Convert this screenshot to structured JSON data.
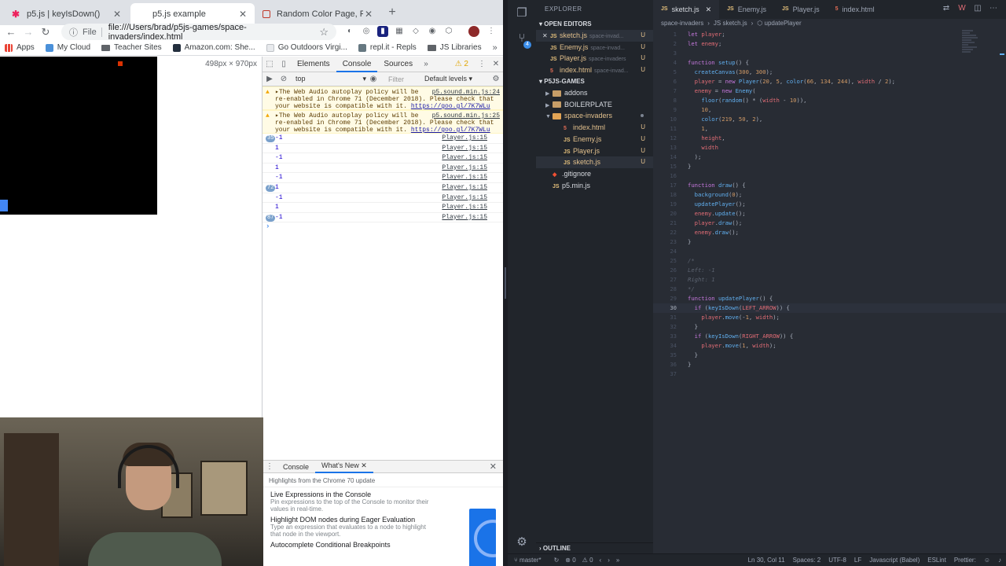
{
  "chrome": {
    "tabs": [
      {
        "title": "p5.js | keyIsDown()",
        "icon": "p5-asterisk-icon",
        "active": false
      },
      {
        "title": "p5.js example",
        "icon": "blank-page-icon",
        "active": true
      },
      {
        "title": "Random Color Page, RGB = db",
        "icon": "page-icon",
        "active": false
      }
    ],
    "new_tab": "+",
    "url_protocol": "File",
    "url": "file:///Users/brad/p5js-games/space-invaders/index.html",
    "bookmarks": [
      {
        "label": "Apps",
        "type": "apps"
      },
      {
        "label": "My Cloud",
        "type": "site"
      },
      {
        "label": "Teacher Sites",
        "type": "folder"
      },
      {
        "label": "Amazon.com: She...",
        "type": "site"
      },
      {
        "label": "Go Outdoors Virgi...",
        "type": "site"
      },
      {
        "label": "repl.it - Repls",
        "type": "site"
      },
      {
        "label": "JS Libraries",
        "type": "folder"
      }
    ],
    "bookmarks_more": "»",
    "viewport_dims": "498px × 970px"
  },
  "game": {
    "canvas_bg": "#000000",
    "enemy_color": "#db3202",
    "player_color": "#4286f4"
  },
  "devtools": {
    "tabs": [
      "Elements",
      "Console",
      "Sources"
    ],
    "more_tabs": "»",
    "active_tab": "Console",
    "warning_count": "⚠ 2",
    "context": "top",
    "filter_placeholder": "Filter",
    "levels": "Default levels ▾",
    "warnings": [
      {
        "text": "▸The Web Audio autoplay policy will be re-enabled in Chrome 71 (December 2018). Please check that your website is compatible with it.",
        "source": "p5.sound.min.js:24",
        "link": "https://goo.gl/7K7WLu"
      },
      {
        "text": "▸The Web Audio autoplay policy will be re-enabled in Chrome 71 (December 2018). Please check that your website is compatible with it.",
        "source": "p5.sound.min.js:25",
        "link": "https://goo.gl/7K7WLu"
      }
    ],
    "logs": [
      {
        "count": "35",
        "value": "-1",
        "source": "Player.js:15"
      },
      {
        "count": "",
        "value": "1",
        "source": "Player.js:15"
      },
      {
        "count": "",
        "value": "-1",
        "source": "Player.js:15"
      },
      {
        "count": "",
        "value": "1",
        "source": "Player.js:15"
      },
      {
        "count": "",
        "value": "-1",
        "source": "Player.js:15"
      },
      {
        "count": "72",
        "value": "1",
        "source": "Player.js:15"
      },
      {
        "count": "",
        "value": "-1",
        "source": "Player.js:15"
      },
      {
        "count": "",
        "value": "1",
        "source": "Player.js:15"
      },
      {
        "count": "87",
        "value": "-1",
        "source": "Player.js:15"
      }
    ],
    "prompt": "›",
    "drawer_tabs": [
      "Console",
      "What's New"
    ],
    "whats_new": {
      "header": "Highlights from the Chrome 70 update",
      "items": [
        {
          "title": "Live Expressions in the Console",
          "desc": "Pin expressions to the top of the Console to monitor their values in real-time."
        },
        {
          "title": "Highlight DOM nodes during Eager Evaluation",
          "desc": "Type an expression that evaluates to a node to highlight that node in the viewport."
        },
        {
          "title": "Autocomplete Conditional Breakpoints",
          "desc": ""
        }
      ]
    }
  },
  "vscode": {
    "explorer_title": "EXPLORER",
    "open_editors_label": "OPEN EDITORS",
    "open_editors": [
      {
        "name": "sketch.js",
        "path": "space-invad...",
        "type": "js",
        "status": "U"
      },
      {
        "name": "Enemy.js",
        "path": "space-invad...",
        "type": "js",
        "status": "U"
      },
      {
        "name": "Player.js",
        "path": "space-invaders",
        "type": "js",
        "status": "U"
      },
      {
        "name": "index.html",
        "path": "space-invad...",
        "type": "html",
        "status": "U"
      }
    ],
    "workspace_label": "P5JS-GAMES",
    "tree": [
      {
        "name": "addons",
        "type": "folder",
        "indent": 1
      },
      {
        "name": "BOILERPLATE",
        "type": "folder",
        "indent": 1
      },
      {
        "name": "space-invaders",
        "type": "folder-open",
        "indent": 1
      },
      {
        "name": "index.html",
        "type": "html",
        "indent": 2,
        "status": "U"
      },
      {
        "name": "Enemy.js",
        "type": "js",
        "indent": 2,
        "status": "U"
      },
      {
        "name": "Player.js",
        "type": "js",
        "indent": 2,
        "status": "U"
      },
      {
        "name": "sketch.js",
        "type": "js",
        "indent": 2,
        "status": "U"
      },
      {
        "name": ".gitignore",
        "type": "git",
        "indent": 1
      },
      {
        "name": "p5.min.js",
        "type": "js",
        "indent": 1
      }
    ],
    "outline_label": "OUTLINE",
    "editor_tabs": [
      {
        "name": "sketch.js",
        "type": "js"
      },
      {
        "name": "Enemy.js",
        "type": "js"
      },
      {
        "name": "Player.js",
        "type": "js"
      },
      {
        "name": "index.html",
        "type": "html"
      }
    ],
    "breadcrumb": [
      "space-invaders",
      "›",
      "JS sketch.js",
      "›",
      "⬡ updatePlayer"
    ],
    "current_line": 30,
    "code": [
      "let player;",
      "let enemy;",
      "",
      "function setup() {",
      "  createCanvas(300, 300);",
      "  player = new Player(20, 5, color(66, 134, 244), width / 2);",
      "  enemy = new Enemy(",
      "    floor(random() * (width - 10)),",
      "    10,",
      "    color(219, 50, 2),",
      "    1,",
      "    height,",
      "    width",
      "  );",
      "}",
      "",
      "function draw() {",
      "  background(0);",
      "  updatePlayer();",
      "  enemy.update();",
      "  player.draw();",
      "  enemy.draw();",
      "}",
      "",
      "/*",
      "Left: -1",
      "Right: 1",
      "*/",
      "function updatePlayer() {",
      "  if (keyIsDown(LEFT_ARROW)) {",
      "    player.move(-1, width);",
      "  }",
      "  if (keyIsDown(RIGHT_ARROW)) {",
      "    player.move(1, width);",
      "  }",
      "}",
      ""
    ],
    "status": {
      "branch": "master*",
      "errors": "⊗ 0",
      "warnings": "⚠ 0",
      "cursor": "Ln 30, Col 11",
      "spaces": "Spaces: 2",
      "encoding": "UTF-8",
      "eol": "LF",
      "language": "Javascript (Babel)",
      "eslint": "ESLint",
      "prettier": "Prettier:"
    },
    "scm_badge": "4"
  }
}
